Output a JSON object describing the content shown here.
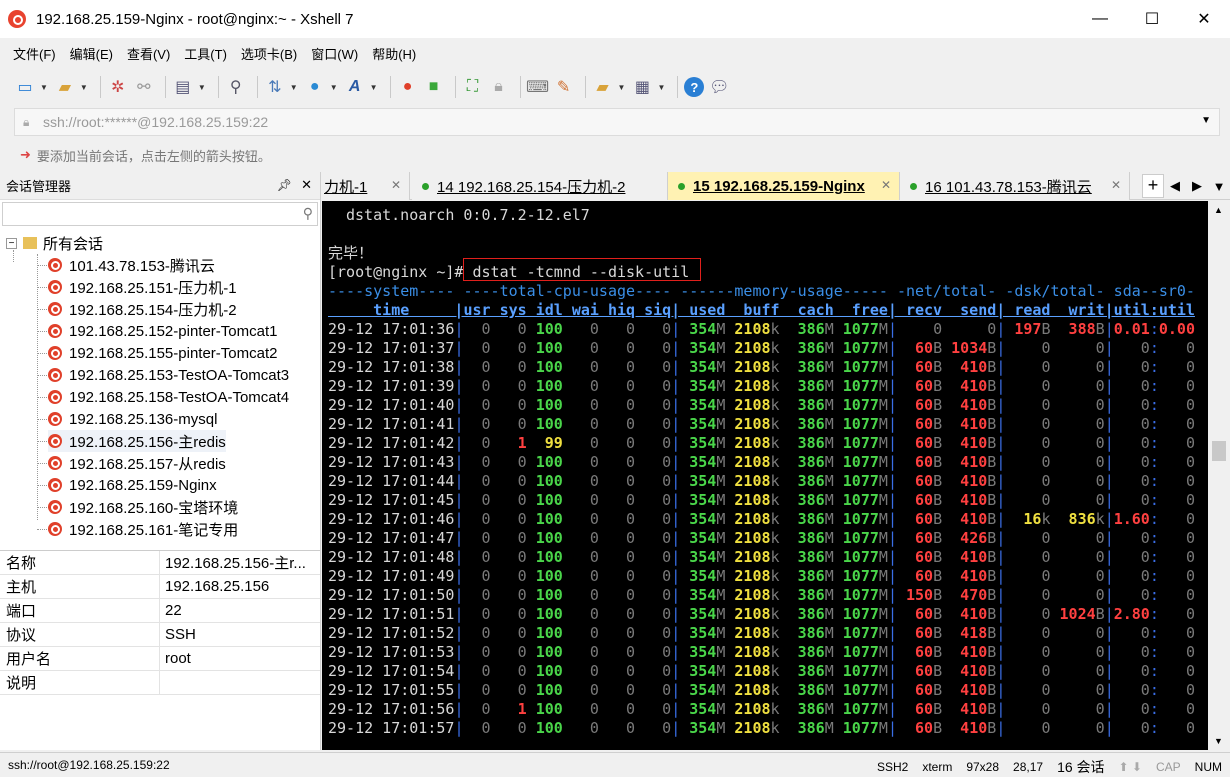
{
  "window": {
    "title": "192.168.25.159-Nginx - root@nginx:~ - Xshell 7",
    "min_glyph": "—",
    "max_glyph": "☐",
    "close_glyph": "✕"
  },
  "menu": [
    "文件(F)",
    "编辑(E)",
    "查看(V)",
    "工具(T)",
    "选项卡(B)",
    "窗口(W)",
    "帮助(H)"
  ],
  "address": {
    "value": "ssh://root:******@192.168.25.159:22"
  },
  "hint": {
    "text": "要添加当前会话，点击左侧的箭头按钮。"
  },
  "session_manager": {
    "title": "会话管理器",
    "root": "所有会话",
    "sessions": [
      "101.43.78.153-腾讯云",
      "192.168.25.151-压力机-1",
      "192.168.25.154-压力机-2",
      "192.168.25.152-pinter-Tomcat1",
      "192.168.25.155-pinter-Tomcat2",
      "192.168.25.153-TestOA-Tomcat3",
      "192.168.25.158-TestOA-Tomcat4",
      "192.168.25.136-mysql",
      "192.168.25.156-主redis",
      "192.168.25.157-从redis",
      "192.168.25.159-Nginx",
      "192.168.25.160-宝塔环境",
      "192.168.25.161-笔记专用"
    ],
    "selected_index": 8
  },
  "properties": [
    {
      "k": "名称",
      "v": "192.168.25.156-主r..."
    },
    {
      "k": "主机",
      "v": "192.168.25.156"
    },
    {
      "k": "端口",
      "v": "22"
    },
    {
      "k": "协议",
      "v": "SSH"
    },
    {
      "k": "用户名",
      "v": "root"
    },
    {
      "k": "说明",
      "v": ""
    }
  ],
  "tabs": [
    {
      "label": "力机-1",
      "dot": false,
      "active": false
    },
    {
      "label": "14 192.168.25.154-压力机-2",
      "dot": true,
      "active": false
    },
    {
      "label": "15 192.168.25.159-Nginx",
      "dot": true,
      "active": true
    },
    {
      "label": "16 101.43.78.153-腾讯云",
      "dot": true,
      "active": false
    }
  ],
  "terminal": {
    "pre_lines": [
      "dstat.noarch 0:0.7.2-12.el7",
      "",
      "完毕！"
    ],
    "prompt": "[root@nginx ~]# ",
    "command": "dstat -tcmnd --disk-util",
    "group_header": "----system---- ----total-cpu-usage---- ------memory-usage----- -net/total- -dsk/total- sda--sr0-",
    "col_header": "     time     |usr sys idl wai hiq siq| used  buff  cach  free| recv  send| read  writ|util:util",
    "rows": [
      {
        "t": "29-12 17:01:36",
        "usr": "0",
        "sys": "0",
        "idl": "100",
        "wai": "0",
        "hiq": "0",
        "siq": "0",
        "used": "354",
        "uu": "M",
        "buff": "2108",
        "bu": "k",
        "cach": "386",
        "cu": "M",
        "free": "1077",
        "fu": "M",
        "recv": "0",
        "ru": "",
        "send": "0",
        "su": "",
        "read": "197",
        "rdu": "B",
        "writ": "388",
        "wu": "B",
        "u1": "0.01",
        "u2": "0.00"
      },
      {
        "t": "29-12 17:01:37",
        "usr": "0",
        "sys": "0",
        "idl": "100",
        "wai": "0",
        "hiq": "0",
        "siq": "0",
        "used": "354",
        "uu": "M",
        "buff": "2108",
        "bu": "k",
        "cach": "386",
        "cu": "M",
        "free": "1077",
        "fu": "M",
        "recv": "60",
        "ru": "B",
        "send": "1034",
        "su": "B",
        "read": "0",
        "rdu": "",
        "writ": "0",
        "wu": "",
        "u1": "0",
        "u2": "0"
      },
      {
        "t": "29-12 17:01:38",
        "usr": "0",
        "sys": "0",
        "idl": "100",
        "wai": "0",
        "hiq": "0",
        "siq": "0",
        "used": "354",
        "uu": "M",
        "buff": "2108",
        "bu": "k",
        "cach": "386",
        "cu": "M",
        "free": "1077",
        "fu": "M",
        "recv": "60",
        "ru": "B",
        "send": "410",
        "su": "B",
        "read": "0",
        "rdu": "",
        "writ": "0",
        "wu": "",
        "u1": "0",
        "u2": "0"
      },
      {
        "t": "29-12 17:01:39",
        "usr": "0",
        "sys": "0",
        "idl": "100",
        "wai": "0",
        "hiq": "0",
        "siq": "0",
        "used": "354",
        "uu": "M",
        "buff": "2108",
        "bu": "k",
        "cach": "386",
        "cu": "M",
        "free": "1077",
        "fu": "M",
        "recv": "60",
        "ru": "B",
        "send": "410",
        "su": "B",
        "read": "0",
        "rdu": "",
        "writ": "0",
        "wu": "",
        "u1": "0",
        "u2": "0"
      },
      {
        "t": "29-12 17:01:40",
        "usr": "0",
        "sys": "0",
        "idl": "100",
        "wai": "0",
        "hiq": "0",
        "siq": "0",
        "used": "354",
        "uu": "M",
        "buff": "2108",
        "bu": "k",
        "cach": "386",
        "cu": "M",
        "free": "1077",
        "fu": "M",
        "recv": "60",
        "ru": "B",
        "send": "410",
        "su": "B",
        "read": "0",
        "rdu": "",
        "writ": "0",
        "wu": "",
        "u1": "0",
        "u2": "0"
      },
      {
        "t": "29-12 17:01:41",
        "usr": "0",
        "sys": "0",
        "idl": "100",
        "wai": "0",
        "hiq": "0",
        "siq": "0",
        "used": "354",
        "uu": "M",
        "buff": "2108",
        "bu": "k",
        "cach": "386",
        "cu": "M",
        "free": "1077",
        "fu": "M",
        "recv": "60",
        "ru": "B",
        "send": "410",
        "su": "B",
        "read": "0",
        "rdu": "",
        "writ": "0",
        "wu": "",
        "u1": "0",
        "u2": "0"
      },
      {
        "t": "29-12 17:01:42",
        "usr": "0",
        "sys": "1",
        "idl": "99",
        "wai": "0",
        "hiq": "0",
        "siq": "0",
        "used": "354",
        "uu": "M",
        "buff": "2108",
        "bu": "k",
        "cach": "386",
        "cu": "M",
        "free": "1077",
        "fu": "M",
        "recv": "60",
        "ru": "B",
        "send": "410",
        "su": "B",
        "read": "0",
        "rdu": "",
        "writ": "0",
        "wu": "",
        "u1": "0",
        "u2": "0"
      },
      {
        "t": "29-12 17:01:43",
        "usr": "0",
        "sys": "0",
        "idl": "100",
        "wai": "0",
        "hiq": "0",
        "siq": "0",
        "used": "354",
        "uu": "M",
        "buff": "2108",
        "bu": "k",
        "cach": "386",
        "cu": "M",
        "free": "1077",
        "fu": "M",
        "recv": "60",
        "ru": "B",
        "send": "410",
        "su": "B",
        "read": "0",
        "rdu": "",
        "writ": "0",
        "wu": "",
        "u1": "0",
        "u2": "0"
      },
      {
        "t": "29-12 17:01:44",
        "usr": "0",
        "sys": "0",
        "idl": "100",
        "wai": "0",
        "hiq": "0",
        "siq": "0",
        "used": "354",
        "uu": "M",
        "buff": "2108",
        "bu": "k",
        "cach": "386",
        "cu": "M",
        "free": "1077",
        "fu": "M",
        "recv": "60",
        "ru": "B",
        "send": "410",
        "su": "B",
        "read": "0",
        "rdu": "",
        "writ": "0",
        "wu": "",
        "u1": "0",
        "u2": "0"
      },
      {
        "t": "29-12 17:01:45",
        "usr": "0",
        "sys": "0",
        "idl": "100",
        "wai": "0",
        "hiq": "0",
        "siq": "0",
        "used": "354",
        "uu": "M",
        "buff": "2108",
        "bu": "k",
        "cach": "386",
        "cu": "M",
        "free": "1077",
        "fu": "M",
        "recv": "60",
        "ru": "B",
        "send": "410",
        "su": "B",
        "read": "0",
        "rdu": "",
        "writ": "0",
        "wu": "",
        "u1": "0",
        "u2": "0"
      },
      {
        "t": "29-12 17:01:46",
        "usr": "0",
        "sys": "0",
        "idl": "100",
        "wai": "0",
        "hiq": "0",
        "siq": "0",
        "used": "354",
        "uu": "M",
        "buff": "2108",
        "bu": "k",
        "cach": "386",
        "cu": "M",
        "free": "1077",
        "fu": "M",
        "recv": "60",
        "ru": "B",
        "send": "410",
        "su": "B",
        "read": "16",
        "rdu": "k",
        "writ": "836",
        "wu": "k",
        "u1": "1.60",
        "u2": "0"
      },
      {
        "t": "29-12 17:01:47",
        "usr": "0",
        "sys": "0",
        "idl": "100",
        "wai": "0",
        "hiq": "0",
        "siq": "0",
        "used": "354",
        "uu": "M",
        "buff": "2108",
        "bu": "k",
        "cach": "386",
        "cu": "M",
        "free": "1077",
        "fu": "M",
        "recv": "60",
        "ru": "B",
        "send": "426",
        "su": "B",
        "read": "0",
        "rdu": "",
        "writ": "0",
        "wu": "",
        "u1": "0",
        "u2": "0"
      },
      {
        "t": "29-12 17:01:48",
        "usr": "0",
        "sys": "0",
        "idl": "100",
        "wai": "0",
        "hiq": "0",
        "siq": "0",
        "used": "354",
        "uu": "M",
        "buff": "2108",
        "bu": "k",
        "cach": "386",
        "cu": "M",
        "free": "1077",
        "fu": "M",
        "recv": "60",
        "ru": "B",
        "send": "410",
        "su": "B",
        "read": "0",
        "rdu": "",
        "writ": "0",
        "wu": "",
        "u1": "0",
        "u2": "0"
      },
      {
        "t": "29-12 17:01:49",
        "usr": "0",
        "sys": "0",
        "idl": "100",
        "wai": "0",
        "hiq": "0",
        "siq": "0",
        "used": "354",
        "uu": "M",
        "buff": "2108",
        "bu": "k",
        "cach": "386",
        "cu": "M",
        "free": "1077",
        "fu": "M",
        "recv": "60",
        "ru": "B",
        "send": "410",
        "su": "B",
        "read": "0",
        "rdu": "",
        "writ": "0",
        "wu": "",
        "u1": "0",
        "u2": "0"
      },
      {
        "t": "29-12 17:01:50",
        "usr": "0",
        "sys": "0",
        "idl": "100",
        "wai": "0",
        "hiq": "0",
        "siq": "0",
        "used": "354",
        "uu": "M",
        "buff": "2108",
        "bu": "k",
        "cach": "386",
        "cu": "M",
        "free": "1077",
        "fu": "M",
        "recv": "150",
        "ru": "B",
        "send": "470",
        "su": "B",
        "read": "0",
        "rdu": "",
        "writ": "0",
        "wu": "",
        "u1": "0",
        "u2": "0"
      },
      {
        "t": "29-12 17:01:51",
        "usr": "0",
        "sys": "0",
        "idl": "100",
        "wai": "0",
        "hiq": "0",
        "siq": "0",
        "used": "354",
        "uu": "M",
        "buff": "2108",
        "bu": "k",
        "cach": "386",
        "cu": "M",
        "free": "1077",
        "fu": "M",
        "recv": "60",
        "ru": "B",
        "send": "410",
        "su": "B",
        "read": "0",
        "rdu": "",
        "writ": "1024",
        "wu": "B",
        "u1": "2.80",
        "u2": "0"
      },
      {
        "t": "29-12 17:01:52",
        "usr": "0",
        "sys": "0",
        "idl": "100",
        "wai": "0",
        "hiq": "0",
        "siq": "0",
        "used": "354",
        "uu": "M",
        "buff": "2108",
        "bu": "k",
        "cach": "386",
        "cu": "M",
        "free": "1077",
        "fu": "M",
        "recv": "60",
        "ru": "B",
        "send": "418",
        "su": "B",
        "read": "0",
        "rdu": "",
        "writ": "0",
        "wu": "",
        "u1": "0",
        "u2": "0"
      },
      {
        "t": "29-12 17:01:53",
        "usr": "0",
        "sys": "0",
        "idl": "100",
        "wai": "0",
        "hiq": "0",
        "siq": "0",
        "used": "354",
        "uu": "M",
        "buff": "2108",
        "bu": "k",
        "cach": "386",
        "cu": "M",
        "free": "1077",
        "fu": "M",
        "recv": "60",
        "ru": "B",
        "send": "410",
        "su": "B",
        "read": "0",
        "rdu": "",
        "writ": "0",
        "wu": "",
        "u1": "0",
        "u2": "0"
      },
      {
        "t": "29-12 17:01:54",
        "usr": "0",
        "sys": "0",
        "idl": "100",
        "wai": "0",
        "hiq": "0",
        "siq": "0",
        "used": "354",
        "uu": "M",
        "buff": "2108",
        "bu": "k",
        "cach": "386",
        "cu": "M",
        "free": "1077",
        "fu": "M",
        "recv": "60",
        "ru": "B",
        "send": "410",
        "su": "B",
        "read": "0",
        "rdu": "",
        "writ": "0",
        "wu": "",
        "u1": "0",
        "u2": "0"
      },
      {
        "t": "29-12 17:01:55",
        "usr": "0",
        "sys": "0",
        "idl": "100",
        "wai": "0",
        "hiq": "0",
        "siq": "0",
        "used": "354",
        "uu": "M",
        "buff": "2108",
        "bu": "k",
        "cach": "386",
        "cu": "M",
        "free": "1077",
        "fu": "M",
        "recv": "60",
        "ru": "B",
        "send": "410",
        "su": "B",
        "read": "0",
        "rdu": "",
        "writ": "0",
        "wu": "",
        "u1": "0",
        "u2": "0"
      },
      {
        "t": "29-12 17:01:56",
        "usr": "0",
        "sys": "1",
        "idl": "100",
        "wai": "0",
        "hiq": "0",
        "siq": "0",
        "used": "354",
        "uu": "M",
        "buff": "2108",
        "bu": "k",
        "cach": "386",
        "cu": "M",
        "free": "1077",
        "fu": "M",
        "recv": "60",
        "ru": "B",
        "send": "410",
        "su": "B",
        "read": "0",
        "rdu": "",
        "writ": "0",
        "wu": "",
        "u1": "0",
        "u2": "0"
      },
      {
        "t": "29-12 17:01:57",
        "usr": "0",
        "sys": "0",
        "idl": "100",
        "wai": "0",
        "hiq": "0",
        "siq": "0",
        "used": "354",
        "uu": "M",
        "buff": "2108",
        "bu": "k",
        "cach": "386",
        "cu": "M",
        "free": "1077",
        "fu": "M",
        "recv": "60",
        "ru": "B",
        "send": "410",
        "su": "B",
        "read": "0",
        "rdu": "",
        "writ": "0",
        "wu": "",
        "u1": "0",
        "u2": "0"
      }
    ]
  },
  "statusbar": {
    "left": "ssh://root@192.168.25.159:22",
    "proto": "SSH2",
    "term": "xterm",
    "size": "97x28",
    "cursor": "28,17",
    "sessions": "16 会话",
    "caps": "CAP",
    "num": "NUM"
  }
}
